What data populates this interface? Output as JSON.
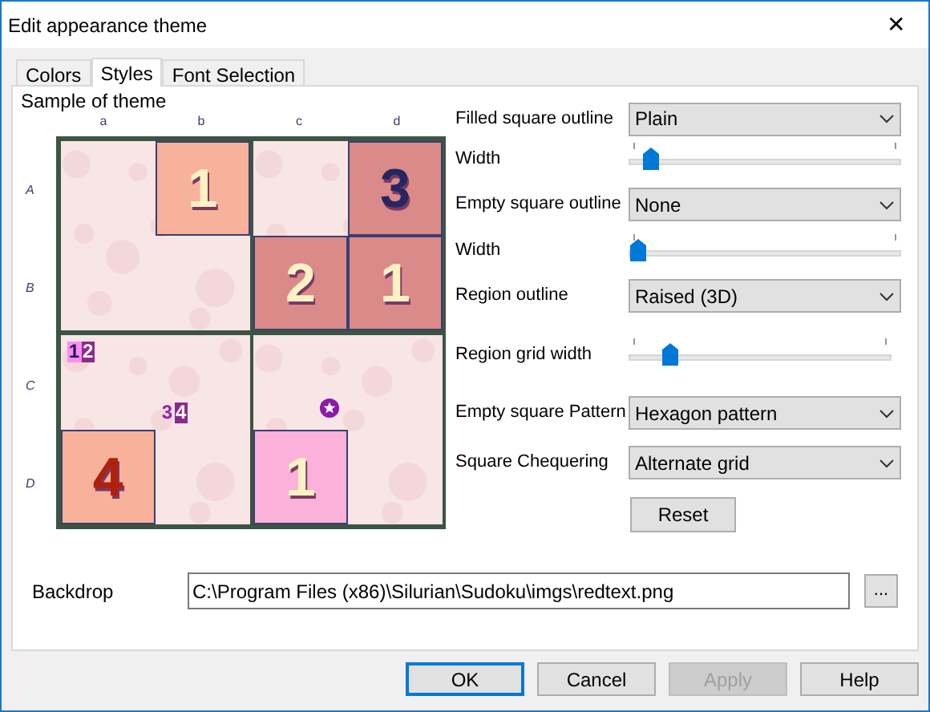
{
  "window": {
    "title": "Edit appearance theme",
    "close": "✕"
  },
  "tabs": [
    {
      "label": "Colors",
      "selected": false
    },
    {
      "label": "Styles",
      "selected": true
    },
    {
      "label": "Font Selection",
      "selected": false
    }
  ],
  "sample": {
    "title": "Sample of theme",
    "columns": [
      "a",
      "b",
      "c",
      "d"
    ],
    "rows": [
      "A",
      "B",
      "C",
      "D"
    ],
    "cells": [
      [
        {},
        {
          "value": "1",
          "color": "#f8b19b",
          "kind": "light"
        },
        {},
        {
          "value": "3",
          "color": "#d98a89",
          "kind": "navy"
        }
      ],
      [
        {},
        {},
        {
          "value": "2",
          "color": "#d98a89",
          "kind": "light"
        },
        {
          "value": "1",
          "color": "#d98a89",
          "kind": "light"
        }
      ],
      [
        {
          "candidates": [
            {
              "digit": "1",
              "kind": "pink"
            },
            {
              "digit": "2",
              "kind": "purple"
            }
          ]
        },
        {
          "candidates": [
            {
              "digit": "3",
              "kind": "plain"
            },
            {
              "digit": "4",
              "kind": "purple"
            }
          ]
        },
        {
          "marker": true
        },
        {}
      ],
      [
        {
          "value": "4",
          "color": "#f8b19b",
          "kind": "red"
        },
        {},
        {
          "value": "1",
          "color": "#fbb1d9",
          "kind": "light"
        },
        {}
      ]
    ]
  },
  "settings": [
    {
      "kind": "dropdown",
      "label": "Filled square outline",
      "value": "Plain"
    },
    {
      "kind": "slider",
      "label": "Width",
      "level": 0.05
    },
    {
      "kind": "dropdown",
      "label": "Empty square outline",
      "value": "None"
    },
    {
      "kind": "slider",
      "label": "Width",
      "level": 0
    },
    {
      "kind": "dropdown",
      "label": "Region outline",
      "value": "Raised (3D)"
    },
    {
      "kind": "slider",
      "label": "Region grid width",
      "level": 0.13
    },
    {
      "kind": "dropdown",
      "label": "Empty square Pattern",
      "value": "Hexagon pattern"
    },
    {
      "kind": "dropdown",
      "label": "Square Chequering",
      "value": "Alternate grid"
    }
  ],
  "reset": {
    "label": "Reset"
  },
  "backdrop": {
    "label": "Backdrop",
    "value": "C:\\Program Files (x86)\\Silurian\\Sudoku\\imgs\\redtext.png",
    "browse": "..."
  },
  "buttons": [
    {
      "label": "OK",
      "default": true,
      "disabled": false
    },
    {
      "label": "Cancel",
      "default": false,
      "disabled": false
    },
    {
      "label": "Apply",
      "default": false,
      "disabled": true
    },
    {
      "label": "Help",
      "default": false,
      "disabled": false
    }
  ]
}
